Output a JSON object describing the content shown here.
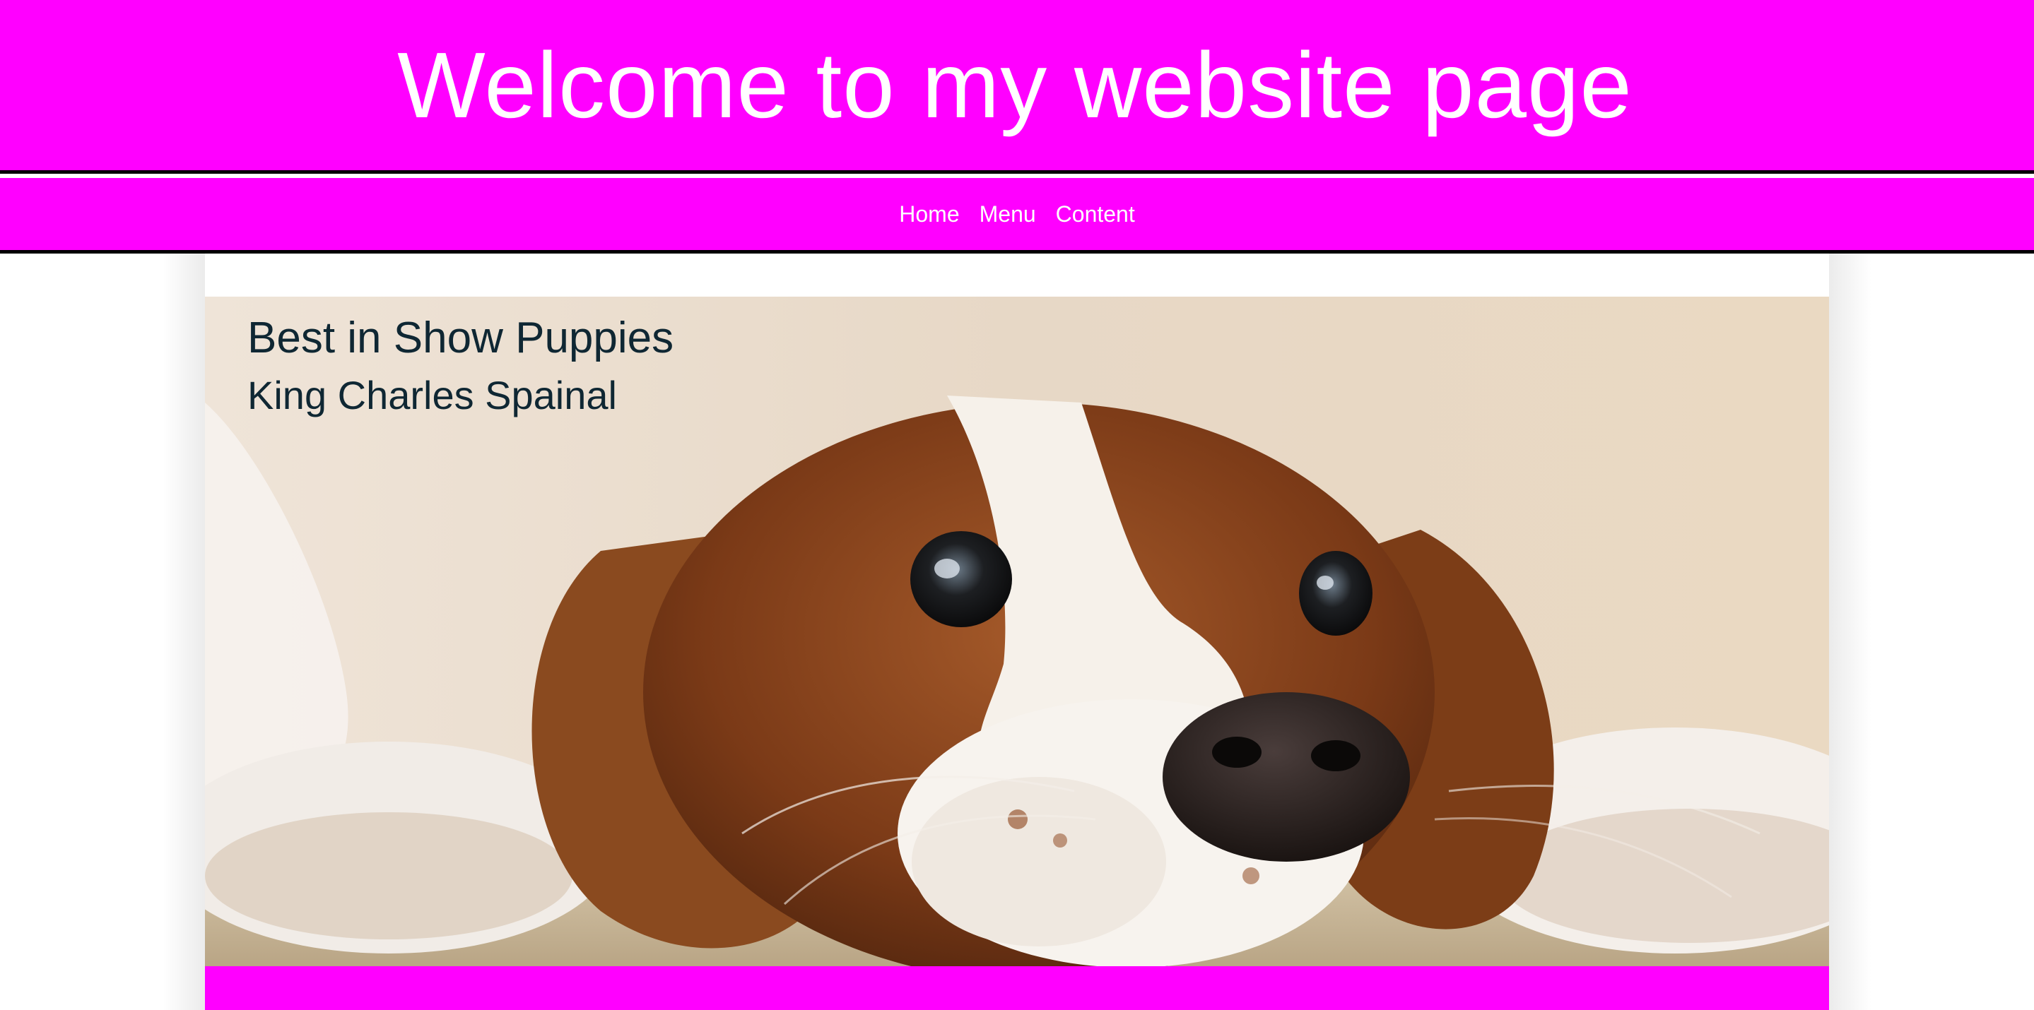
{
  "header": {
    "title": "Welcome to my website page"
  },
  "nav": {
    "items": [
      {
        "label": "Home"
      },
      {
        "label": "Menu"
      },
      {
        "label": "Content"
      }
    ]
  },
  "hero": {
    "title": "Best in Show Puppies",
    "subtitle": "King Charles Spainal",
    "image_subject": "cavalier-king-charles-spaniel-photo"
  },
  "colors": {
    "brand": "#ff00ff",
    "header_text": "#ffffff",
    "hero_text": "#0f2733",
    "divider": "#000000"
  }
}
